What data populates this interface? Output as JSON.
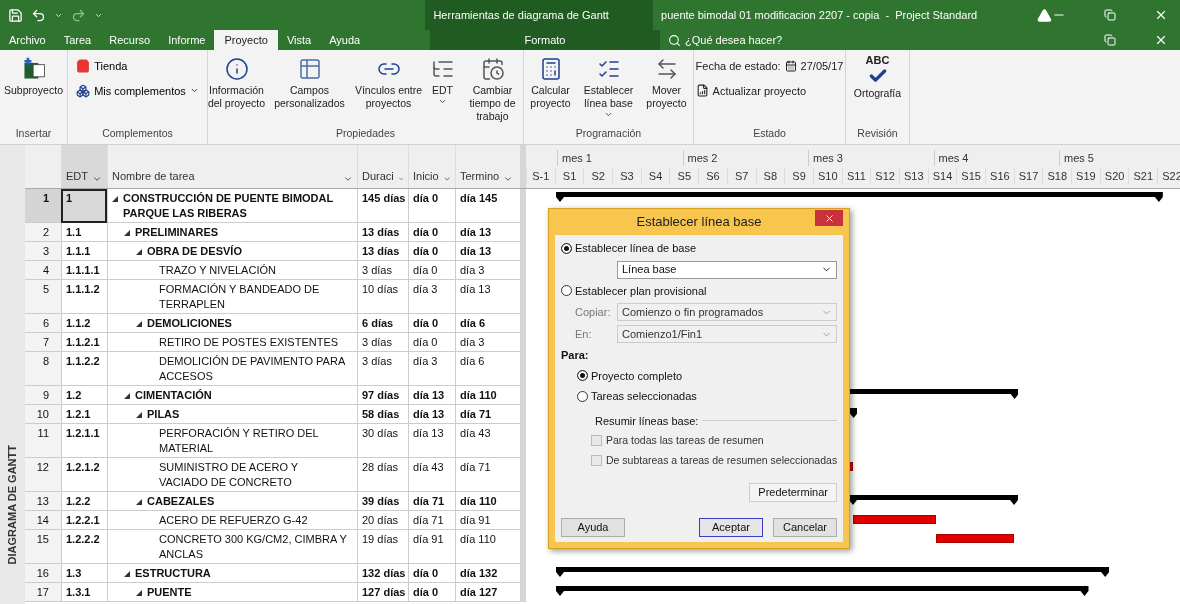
{
  "title_bar": {
    "context_label": "Herramientas de diagrama de Gantt",
    "title": "puente bimodal 01 modificacion 2207 - copia  -  Project Standard"
  },
  "tabs": [
    {
      "label": "Archivo",
      "selected": false,
      "kind": "file"
    },
    {
      "label": "Tarea",
      "selected": false,
      "kind": "main"
    },
    {
      "label": "Recurso",
      "selected": false,
      "kind": "main"
    },
    {
      "label": "Informe",
      "selected": false,
      "kind": "main"
    },
    {
      "label": "Proyecto",
      "selected": true,
      "kind": "main"
    },
    {
      "label": "Vista",
      "selected": false,
      "kind": "main"
    },
    {
      "label": "Ayuda",
      "selected": false,
      "kind": "main"
    },
    {
      "label": "Formato",
      "selected": false,
      "kind": "context"
    }
  ],
  "search": {
    "placeholder": "¿Qué desea hacer?"
  },
  "ribbon": {
    "groups": [
      {
        "label": "Insertar",
        "buttons": [
          {
            "label": "Subproyecto",
            "has_menu": false
          }
        ]
      },
      {
        "label": "Complementos",
        "buttons": [
          {
            "label": "Tienda",
            "has_menu": false
          },
          {
            "label": "Mis complementos",
            "has_menu": true
          }
        ]
      },
      {
        "label": "Propiedades",
        "buttons": [
          {
            "label": "Información del proyecto",
            "has_menu": false
          },
          {
            "label": "Campos personalizados",
            "has_menu": false
          },
          {
            "label": "Vínculos entre proyectos",
            "has_menu": false
          },
          {
            "label": "EDT",
            "has_menu": true
          },
          {
            "label": "Cambiar tiempo de trabajo",
            "has_menu": false
          }
        ]
      },
      {
        "label": "Programación",
        "buttons": [
          {
            "label": "Calcular proyecto",
            "has_menu": false
          },
          {
            "label": "Establecer línea base",
            "has_menu": true
          },
          {
            "label": "Mover proyecto",
            "has_menu": false
          }
        ]
      },
      {
        "label": "Estado",
        "status_date": {
          "label": "Fecha de estado:",
          "value": "27/05/17"
        },
        "buttons": [
          {
            "label": "Actualizar proyecto",
            "has_menu": false
          }
        ]
      },
      {
        "label": "Revisión",
        "icon_text": "ABC",
        "buttons": [
          {
            "label": "Ortografía",
            "has_menu": false
          }
        ]
      }
    ]
  },
  "view_label": "DIAGRAMA DE GANTT",
  "table": {
    "columns": [
      {
        "label": "EDT"
      },
      {
        "label": "Nombre de tarea"
      },
      {
        "label": "Duraci"
      },
      {
        "label": "Inicio"
      },
      {
        "label": "Termino"
      }
    ],
    "rows": [
      {
        "num": "1",
        "edt": "1",
        "name": "CONSTRUCCIÓN DE PUENTE BIMODAL PARQUE LAS RIBERAS",
        "duration": "145 días",
        "start": "día 0",
        "finish": "día 145",
        "kind": "summary",
        "expanded": true,
        "selected": true,
        "children": [
          {
            "num": "2",
            "edt": "1.1",
            "name": "PRELIMINARES",
            "duration": "13 días",
            "start": "día 0",
            "finish": "día 13",
            "kind": "summary",
            "expanded": true,
            "selected": false,
            "children": [
              {
                "num": "3",
                "edt": "1.1.1",
                "name": "OBRA DE DESVÍO",
                "duration": "13 días",
                "start": "día 0",
                "finish": "día 13",
                "kind": "summary",
                "expanded": true,
                "selected": false,
                "children": [
                  {
                    "num": "4",
                    "edt": "1.1.1.1",
                    "name": "TRAZO Y NIVELACIÓN",
                    "duration": "3 días",
                    "start": "día 0",
                    "finish": "día 3",
                    "kind": "task",
                    "selected": false
                  },
                  {
                    "num": "5",
                    "edt": "1.1.1.2",
                    "name": "FORMACIÓN Y BANDEADO DE TERRAPLEN",
                    "duration": "10 días",
                    "start": "día 3",
                    "finish": "día 13",
                    "kind": "task",
                    "selected": false
                  }
                ]
              },
              {
                "num": "6",
                "edt": "1.1.2",
                "name": "DEMOLICIONES",
                "duration": "6 días",
                "start": "día 0",
                "finish": "día 6",
                "kind": "summary",
                "expanded": true,
                "selected": false,
                "children": [
                  {
                    "num": "7",
                    "edt": "1.1.2.1",
                    "name": "RETIRO DE POSTES EXISTENTES",
                    "duration": "3 días",
                    "start": "día 0",
                    "finish": "día 3",
                    "kind": "task",
                    "selected": false
                  },
                  {
                    "num": "8",
                    "edt": "1.1.2.2",
                    "name": "DEMOLICIÓN DE PAVIMENTO PARA ACCESOS",
                    "duration": "3 días",
                    "start": "día 3",
                    "finish": "día 6",
                    "kind": "task",
                    "selected": false
                  }
                ]
              }
            ]
          },
          {
            "num": "9",
            "edt": "1.2",
            "name": "CIMENTACIÓN",
            "duration": "97 días",
            "start": "día 13",
            "finish": "día 110",
            "kind": "summary",
            "expanded": true,
            "selected": false,
            "children": [
              {
                "num": "10",
                "edt": "1.2.1",
                "name": "PILAS",
                "duration": "58 días",
                "start": "día 13",
                "finish": "día 71",
                "kind": "summary",
                "expanded": true,
                "selected": false,
                "children": [
                  {
                    "num": "11",
                    "edt": "1.2.1.1",
                    "name": "PERFORACIÓN Y RETIRO DEL MATERIAL",
                    "duration": "30 días",
                    "start": "día 13",
                    "finish": "día 43",
                    "kind": "task",
                    "selected": false
                  },
                  {
                    "num": "12",
                    "edt": "1.2.1.2",
                    "name": "SUMINISTRO DE ACERO Y VACIADO DE CONCRETO",
                    "duration": "28 días",
                    "start": "día 43",
                    "finish": "día 71",
                    "kind": "task",
                    "selected": false
                  }
                ]
              },
              {
                "num": "13",
                "edt": "1.2.2",
                "name": "CABEZALES",
                "duration": "39 días",
                "start": "día 71",
                "finish": "día 110",
                "kind": "summary",
                "expanded": true,
                "selected": false,
                "children": [
                  {
                    "num": "14",
                    "edt": "1.2.2.1",
                    "name": "ACERO DE REFUERZO G-42",
                    "duration": "20 días",
                    "start": "día 71",
                    "finish": "día 91",
                    "kind": "task",
                    "selected": false
                  },
                  {
                    "num": "15",
                    "edt": "1.2.2.2",
                    "name": "CONCRETO 300 KG/CM2, CIMBRA Y ANCLAS",
                    "duration": "19 días",
                    "start": "día 91",
                    "finish": "día 110",
                    "kind": "task",
                    "selected": false
                  }
                ]
              }
            ]
          },
          {
            "num": "16",
            "edt": "1.3",
            "name": "ESTRUCTURA",
            "duration": "132 días",
            "start": "día 0",
            "finish": "día 132",
            "kind": "summary",
            "expanded": true,
            "selected": false,
            "children": [
              {
                "num": "17",
                "edt": "1.3.1",
                "name": "PUENTE",
                "duration": "127 días",
                "start": "día 0",
                "finish": "día 127",
                "kind": "summary",
                "expanded": true,
                "selected": false
              }
            ]
          }
        ]
      }
    ]
  },
  "timeline": {
    "months": [
      "mes 1",
      "mes 2",
      "mes 3",
      "mes 4",
      "mes 5"
    ],
    "weeks": [
      "S-1",
      "S1",
      "S2",
      "S3",
      "S4",
      "S5",
      "S6",
      "S7",
      "S8",
      "S9",
      "S10",
      "S11",
      "S12",
      "S13",
      "S14",
      "S15",
      "S16",
      "S17",
      "S18",
      "S19",
      "S20",
      "S21",
      "S22"
    ]
  },
  "dialog": {
    "title": "Establecer línea base",
    "modes": [
      {
        "label": "Establecer línea de base",
        "selected": true
      },
      {
        "label": "Establecer plan provisional",
        "selected": false
      }
    ],
    "baseline_value": "Línea base",
    "copy": {
      "label": "Copiar:",
      "value": "Comienzo o fin programados",
      "disabled": true
    },
    "into": {
      "label": "En:",
      "value": "Comienzo1/Fin1",
      "disabled": true
    },
    "for_label": "Para:",
    "scope": [
      {
        "label": "Proyecto completo",
        "selected": true
      },
      {
        "label": "Tareas seleccionadas",
        "selected": false
      }
    ],
    "rollup_label": "Resumir líneas base:",
    "rollup": [
      {
        "label": "Para todas las tareas de resumen",
        "checked": false,
        "disabled": true
      },
      {
        "label": "De subtareas a tareas de resumen seleccionadas",
        "checked": false,
        "disabled": true
      }
    ],
    "buttons": {
      "reset": "Predeterminar",
      "help": "Ayuda",
      "ok": "Aceptar",
      "cancel": "Cancelar"
    }
  }
}
